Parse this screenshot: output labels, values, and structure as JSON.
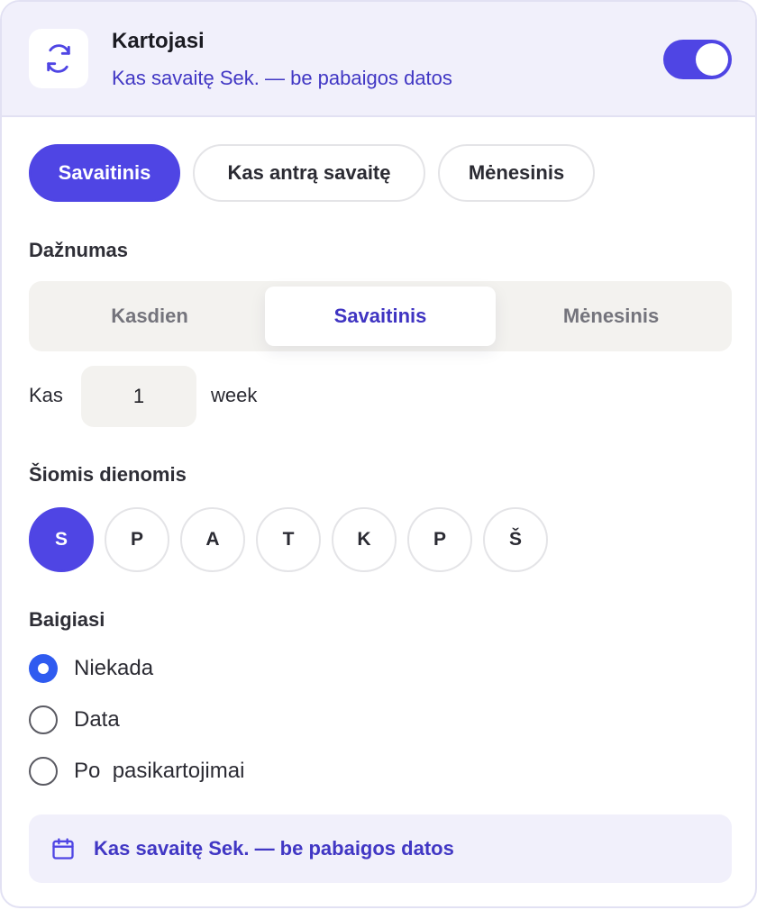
{
  "header": {
    "title": "Kartojasi",
    "subtitle": "Kas savaitę Sek. — be pabaigos datos",
    "icon": "repeat-icon",
    "toggle_on": true
  },
  "presets": [
    "Savaitinis",
    "Kas antrą savaitę",
    "Mėnesinis"
  ],
  "frequency": {
    "label": "Dažnumas",
    "options": [
      "Kasdien",
      "Savaitinis",
      "Mėnesinis"
    ],
    "selected": "Savaitinis"
  },
  "interval": {
    "prefix": "Kas",
    "value": "1",
    "unit": "week"
  },
  "days": {
    "label": "Šiomis dienomis",
    "items": [
      "S",
      "P",
      "A",
      "T",
      "K",
      "P",
      "Š"
    ],
    "selected": [
      "S"
    ]
  },
  "ends": {
    "label": "Baigiasi",
    "options": [
      "Niekada",
      "Data",
      "Po  pasikartojimai"
    ],
    "selected": "Niekada"
  },
  "summary": {
    "icon": "calendar-icon",
    "text": "Kas savaitę Sek. — be pabaigos datos"
  },
  "colors": {
    "accent": "#4f45e4",
    "accent_text": "#4137c4",
    "radio_checked": "#2f5bf0",
    "header_bg": "#f1f0fb"
  }
}
